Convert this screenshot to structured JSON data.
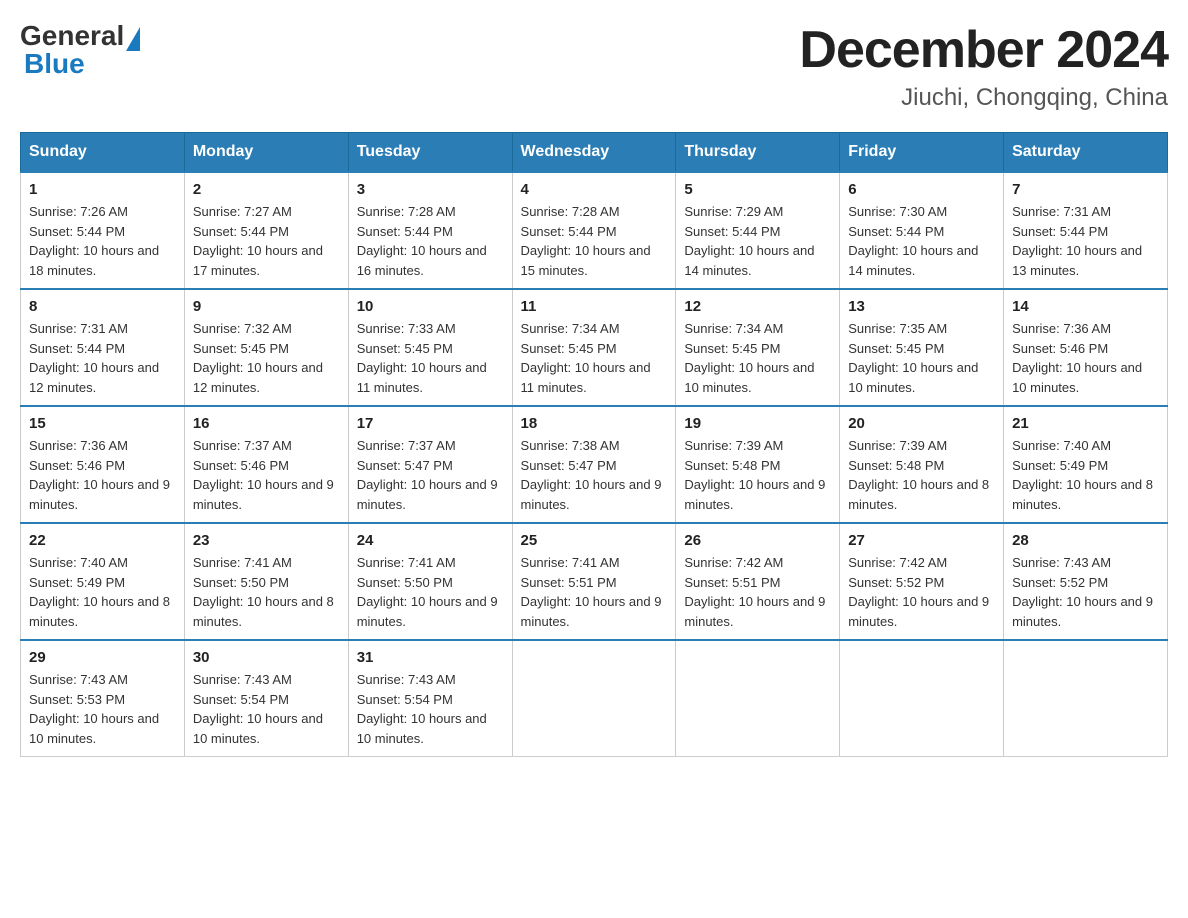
{
  "header": {
    "logo_general": "General",
    "logo_blue": "Blue",
    "month_title": "December 2024",
    "location": "Jiuchi, Chongqing, China"
  },
  "days_of_week": [
    "Sunday",
    "Monday",
    "Tuesday",
    "Wednesday",
    "Thursday",
    "Friday",
    "Saturday"
  ],
  "weeks": [
    [
      {
        "day": "1",
        "sunrise": "7:26 AM",
        "sunset": "5:44 PM",
        "daylight": "10 hours and 18 minutes."
      },
      {
        "day": "2",
        "sunrise": "7:27 AM",
        "sunset": "5:44 PM",
        "daylight": "10 hours and 17 minutes."
      },
      {
        "day": "3",
        "sunrise": "7:28 AM",
        "sunset": "5:44 PM",
        "daylight": "10 hours and 16 minutes."
      },
      {
        "day": "4",
        "sunrise": "7:28 AM",
        "sunset": "5:44 PM",
        "daylight": "10 hours and 15 minutes."
      },
      {
        "day": "5",
        "sunrise": "7:29 AM",
        "sunset": "5:44 PM",
        "daylight": "10 hours and 14 minutes."
      },
      {
        "day": "6",
        "sunrise": "7:30 AM",
        "sunset": "5:44 PM",
        "daylight": "10 hours and 14 minutes."
      },
      {
        "day": "7",
        "sunrise": "7:31 AM",
        "sunset": "5:44 PM",
        "daylight": "10 hours and 13 minutes."
      }
    ],
    [
      {
        "day": "8",
        "sunrise": "7:31 AM",
        "sunset": "5:44 PM",
        "daylight": "10 hours and 12 minutes."
      },
      {
        "day": "9",
        "sunrise": "7:32 AM",
        "sunset": "5:45 PM",
        "daylight": "10 hours and 12 minutes."
      },
      {
        "day": "10",
        "sunrise": "7:33 AM",
        "sunset": "5:45 PM",
        "daylight": "10 hours and 11 minutes."
      },
      {
        "day": "11",
        "sunrise": "7:34 AM",
        "sunset": "5:45 PM",
        "daylight": "10 hours and 11 minutes."
      },
      {
        "day": "12",
        "sunrise": "7:34 AM",
        "sunset": "5:45 PM",
        "daylight": "10 hours and 10 minutes."
      },
      {
        "day": "13",
        "sunrise": "7:35 AM",
        "sunset": "5:45 PM",
        "daylight": "10 hours and 10 minutes."
      },
      {
        "day": "14",
        "sunrise": "7:36 AM",
        "sunset": "5:46 PM",
        "daylight": "10 hours and 10 minutes."
      }
    ],
    [
      {
        "day": "15",
        "sunrise": "7:36 AM",
        "sunset": "5:46 PM",
        "daylight": "10 hours and 9 minutes."
      },
      {
        "day": "16",
        "sunrise": "7:37 AM",
        "sunset": "5:46 PM",
        "daylight": "10 hours and 9 minutes."
      },
      {
        "day": "17",
        "sunrise": "7:37 AM",
        "sunset": "5:47 PM",
        "daylight": "10 hours and 9 minutes."
      },
      {
        "day": "18",
        "sunrise": "7:38 AM",
        "sunset": "5:47 PM",
        "daylight": "10 hours and 9 minutes."
      },
      {
        "day": "19",
        "sunrise": "7:39 AM",
        "sunset": "5:48 PM",
        "daylight": "10 hours and 9 minutes."
      },
      {
        "day": "20",
        "sunrise": "7:39 AM",
        "sunset": "5:48 PM",
        "daylight": "10 hours and 8 minutes."
      },
      {
        "day": "21",
        "sunrise": "7:40 AM",
        "sunset": "5:49 PM",
        "daylight": "10 hours and 8 minutes."
      }
    ],
    [
      {
        "day": "22",
        "sunrise": "7:40 AM",
        "sunset": "5:49 PM",
        "daylight": "10 hours and 8 minutes."
      },
      {
        "day": "23",
        "sunrise": "7:41 AM",
        "sunset": "5:50 PM",
        "daylight": "10 hours and 8 minutes."
      },
      {
        "day": "24",
        "sunrise": "7:41 AM",
        "sunset": "5:50 PM",
        "daylight": "10 hours and 9 minutes."
      },
      {
        "day": "25",
        "sunrise": "7:41 AM",
        "sunset": "5:51 PM",
        "daylight": "10 hours and 9 minutes."
      },
      {
        "day": "26",
        "sunrise": "7:42 AM",
        "sunset": "5:51 PM",
        "daylight": "10 hours and 9 minutes."
      },
      {
        "day": "27",
        "sunrise": "7:42 AM",
        "sunset": "5:52 PM",
        "daylight": "10 hours and 9 minutes."
      },
      {
        "day": "28",
        "sunrise": "7:43 AM",
        "sunset": "5:52 PM",
        "daylight": "10 hours and 9 minutes."
      }
    ],
    [
      {
        "day": "29",
        "sunrise": "7:43 AM",
        "sunset": "5:53 PM",
        "daylight": "10 hours and 10 minutes."
      },
      {
        "day": "30",
        "sunrise": "7:43 AM",
        "sunset": "5:54 PM",
        "daylight": "10 hours and 10 minutes."
      },
      {
        "day": "31",
        "sunrise": "7:43 AM",
        "sunset": "5:54 PM",
        "daylight": "10 hours and 10 minutes."
      },
      null,
      null,
      null,
      null
    ]
  ]
}
